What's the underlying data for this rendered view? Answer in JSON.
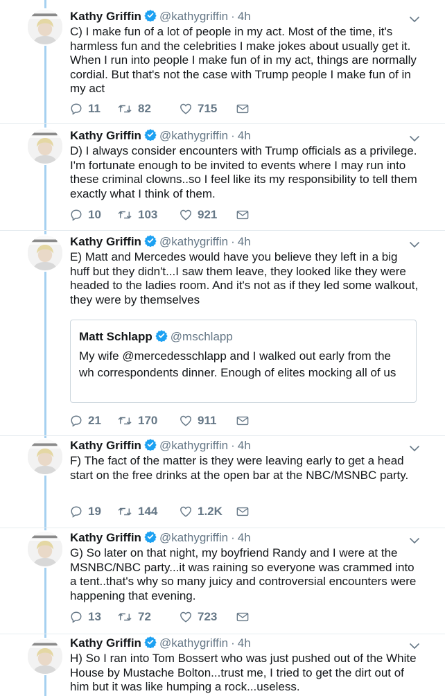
{
  "colors": {
    "accent": "#1da1f2",
    "thread_line": "#a5d0f0",
    "muted": "#657786",
    "text": "#14171a"
  },
  "tweets": [
    {
      "name": "Kathy Griffin",
      "handle": "@kathygriffin",
      "separator": "·",
      "time": "4h",
      "text": "C) I make fun of a lot of people in my act. Most of the time, it's harmless fun and the celebrities I make jokes about usually get it. When I run into people I make fun of in my act, things are normally cordial. But that's not the case with Trump people I make fun of in my act",
      "replies": "11",
      "retweets": "82",
      "likes": "715"
    },
    {
      "name": "Kathy Griffin",
      "handle": "@kathygriffin",
      "separator": "·",
      "time": "4h",
      "text": "D) I always consider encounters with Trump officials as a privilege. I'm fortunate enough to be invited to events where I may run into these criminal clowns..so I feel like its my responsibility to tell them exactly what I think of them.",
      "replies": "10",
      "retweets": "103",
      "likes": "921"
    },
    {
      "name": "Kathy Griffin",
      "handle": "@kathygriffin",
      "separator": "·",
      "time": "4h",
      "text": "E)  Matt and Mercedes would have you believe they left in a big huff but they didn't...I saw them leave, they looked like they were headed to the ladies room. And it's not as if they led some walkout, they were by themselves",
      "quote": {
        "name": "Matt Schlapp",
        "handle": "@mschlapp",
        "text": "My wife @mercedesschlapp and I walked out early from the wh correspondents dinner. Enough of elites mocking all of us"
      },
      "replies": "21",
      "retweets": "170",
      "likes": "911"
    },
    {
      "name": "Kathy Griffin",
      "handle": "@kathygriffin",
      "separator": "·",
      "time": "4h",
      "text": "F) The fact of the matter is they were leaving early to get a head start on the free drinks at the open bar at the NBC/MSNBC party.",
      "replies": "19",
      "retweets": "144",
      "likes": "1.2K"
    },
    {
      "name": "Kathy Griffin",
      "handle": "@kathygriffin",
      "separator": "·",
      "time": "4h",
      "text": "G) So later on that night, my boyfriend Randy and I were at the MSNBC/NBC party...it was raining so everyone was crammed into a tent..that's why so many juicy and controversial encounters were happening that evening.",
      "replies": "13",
      "retweets": "72",
      "likes": "723"
    },
    {
      "name": "Kathy Griffin",
      "handle": "@kathygriffin",
      "separator": "·",
      "time": "4h",
      "text": "H) So I ran into Tom Bossert who was just pushed out of the White House by Mustache Bolton...trust me, I tried to get the dirt out of him but it was like humping a rock...useless."
    }
  ]
}
